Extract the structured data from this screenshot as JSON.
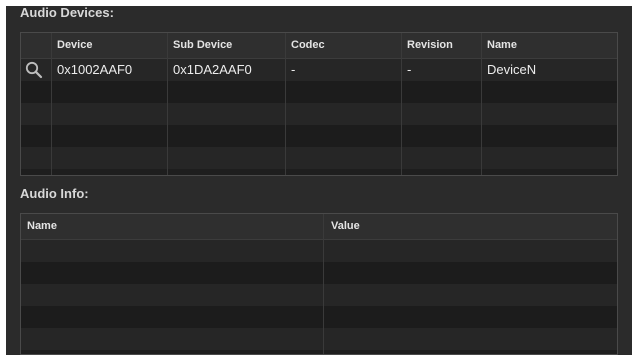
{
  "audio_devices": {
    "title": "Audio Devices:",
    "columns": [
      "Device",
      "Sub Device",
      "Codec",
      "Revision",
      "Name"
    ],
    "rows": [
      {
        "icon": "magnifier-icon",
        "device": "0x1002AAF0",
        "sub_device": "0x1DA2AAF0",
        "codec": "-",
        "revision": "-",
        "name": "DeviceN"
      }
    ]
  },
  "audio_info": {
    "title": "Audio Info:",
    "columns": [
      "Name",
      "Value"
    ],
    "rows": []
  },
  "colors": {
    "panel_bg": "#2b2b2b",
    "header_bg": "#2f2f2f",
    "row_alt": "#262626",
    "row_base": "#1c1c1c",
    "text": "#ededed"
  }
}
